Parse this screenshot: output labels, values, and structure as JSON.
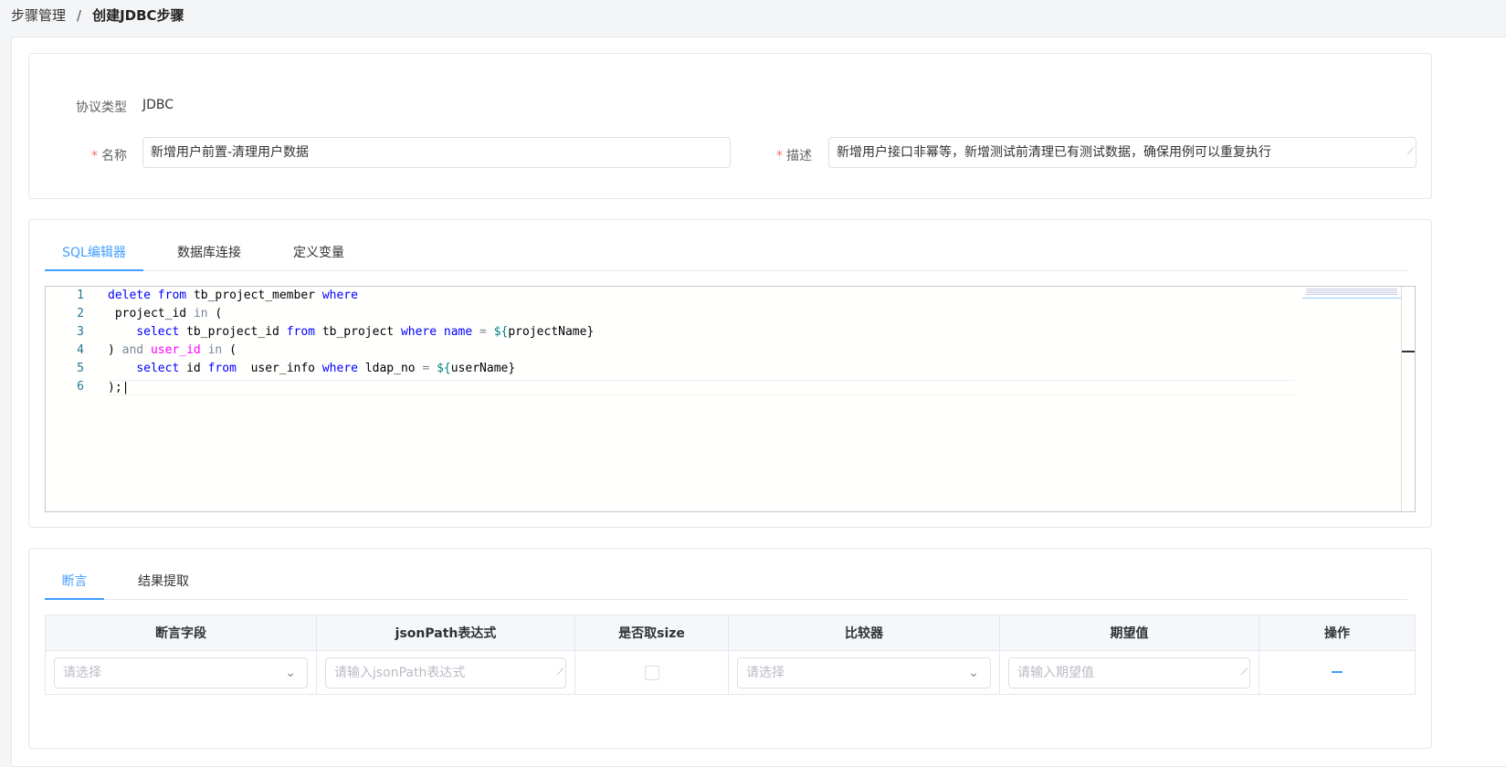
{
  "breadcrumb": {
    "parent": "步骤管理",
    "separator": "/",
    "current": "创建JDBC步骤"
  },
  "form": {
    "protocol_label": "协议类型",
    "protocol_value": "JDBC",
    "name_label": "名称",
    "name_value": "新增用户前置-清理用户数据",
    "desc_label": "描述",
    "desc_value": "新增用户接口非幂等，新增测试前清理已有测试数据，确保用例可以重复执行"
  },
  "editor_tabs": [
    {
      "label": "SQL编辑器",
      "active": true
    },
    {
      "label": "数据库连接"
    },
    {
      "label": "定义变量"
    }
  ],
  "sql_lines": [
    "1",
    "2",
    "3",
    "4",
    "5",
    "6"
  ],
  "sql_code": {
    "l1": [
      "delete",
      "from",
      "tb_project_member",
      "where"
    ],
    "l2": [
      "project_id",
      "in",
      "("
    ],
    "l3": [
      "select",
      "tb_project_id",
      "from",
      "tb_project",
      "where",
      "name",
      "=",
      "${",
      "projectName}"
    ],
    "l4": [
      ")",
      "and",
      "user_id",
      "in",
      "("
    ],
    "l5": [
      "select",
      "id",
      "from",
      "user_info",
      "where",
      "ldap_no",
      "=",
      "${",
      "userName}"
    ],
    "l6": [
      ");"
    ]
  },
  "assert_tabs": [
    {
      "label": "断言",
      "active": true
    },
    {
      "label": "结果提取"
    }
  ],
  "table": {
    "headers": [
      "断言字段",
      "jsonPath表达式",
      "是否取size",
      "比较器",
      "期望值",
      "操作"
    ],
    "row": {
      "field_placeholder": "请选择",
      "jsonpath_placeholder": "请输入jsonPath表达式",
      "comparator_placeholder": "请选择",
      "expected_placeholder": "请输入期望值"
    }
  },
  "colors": {
    "accent": "#409eff",
    "required": "#f56c6c"
  }
}
